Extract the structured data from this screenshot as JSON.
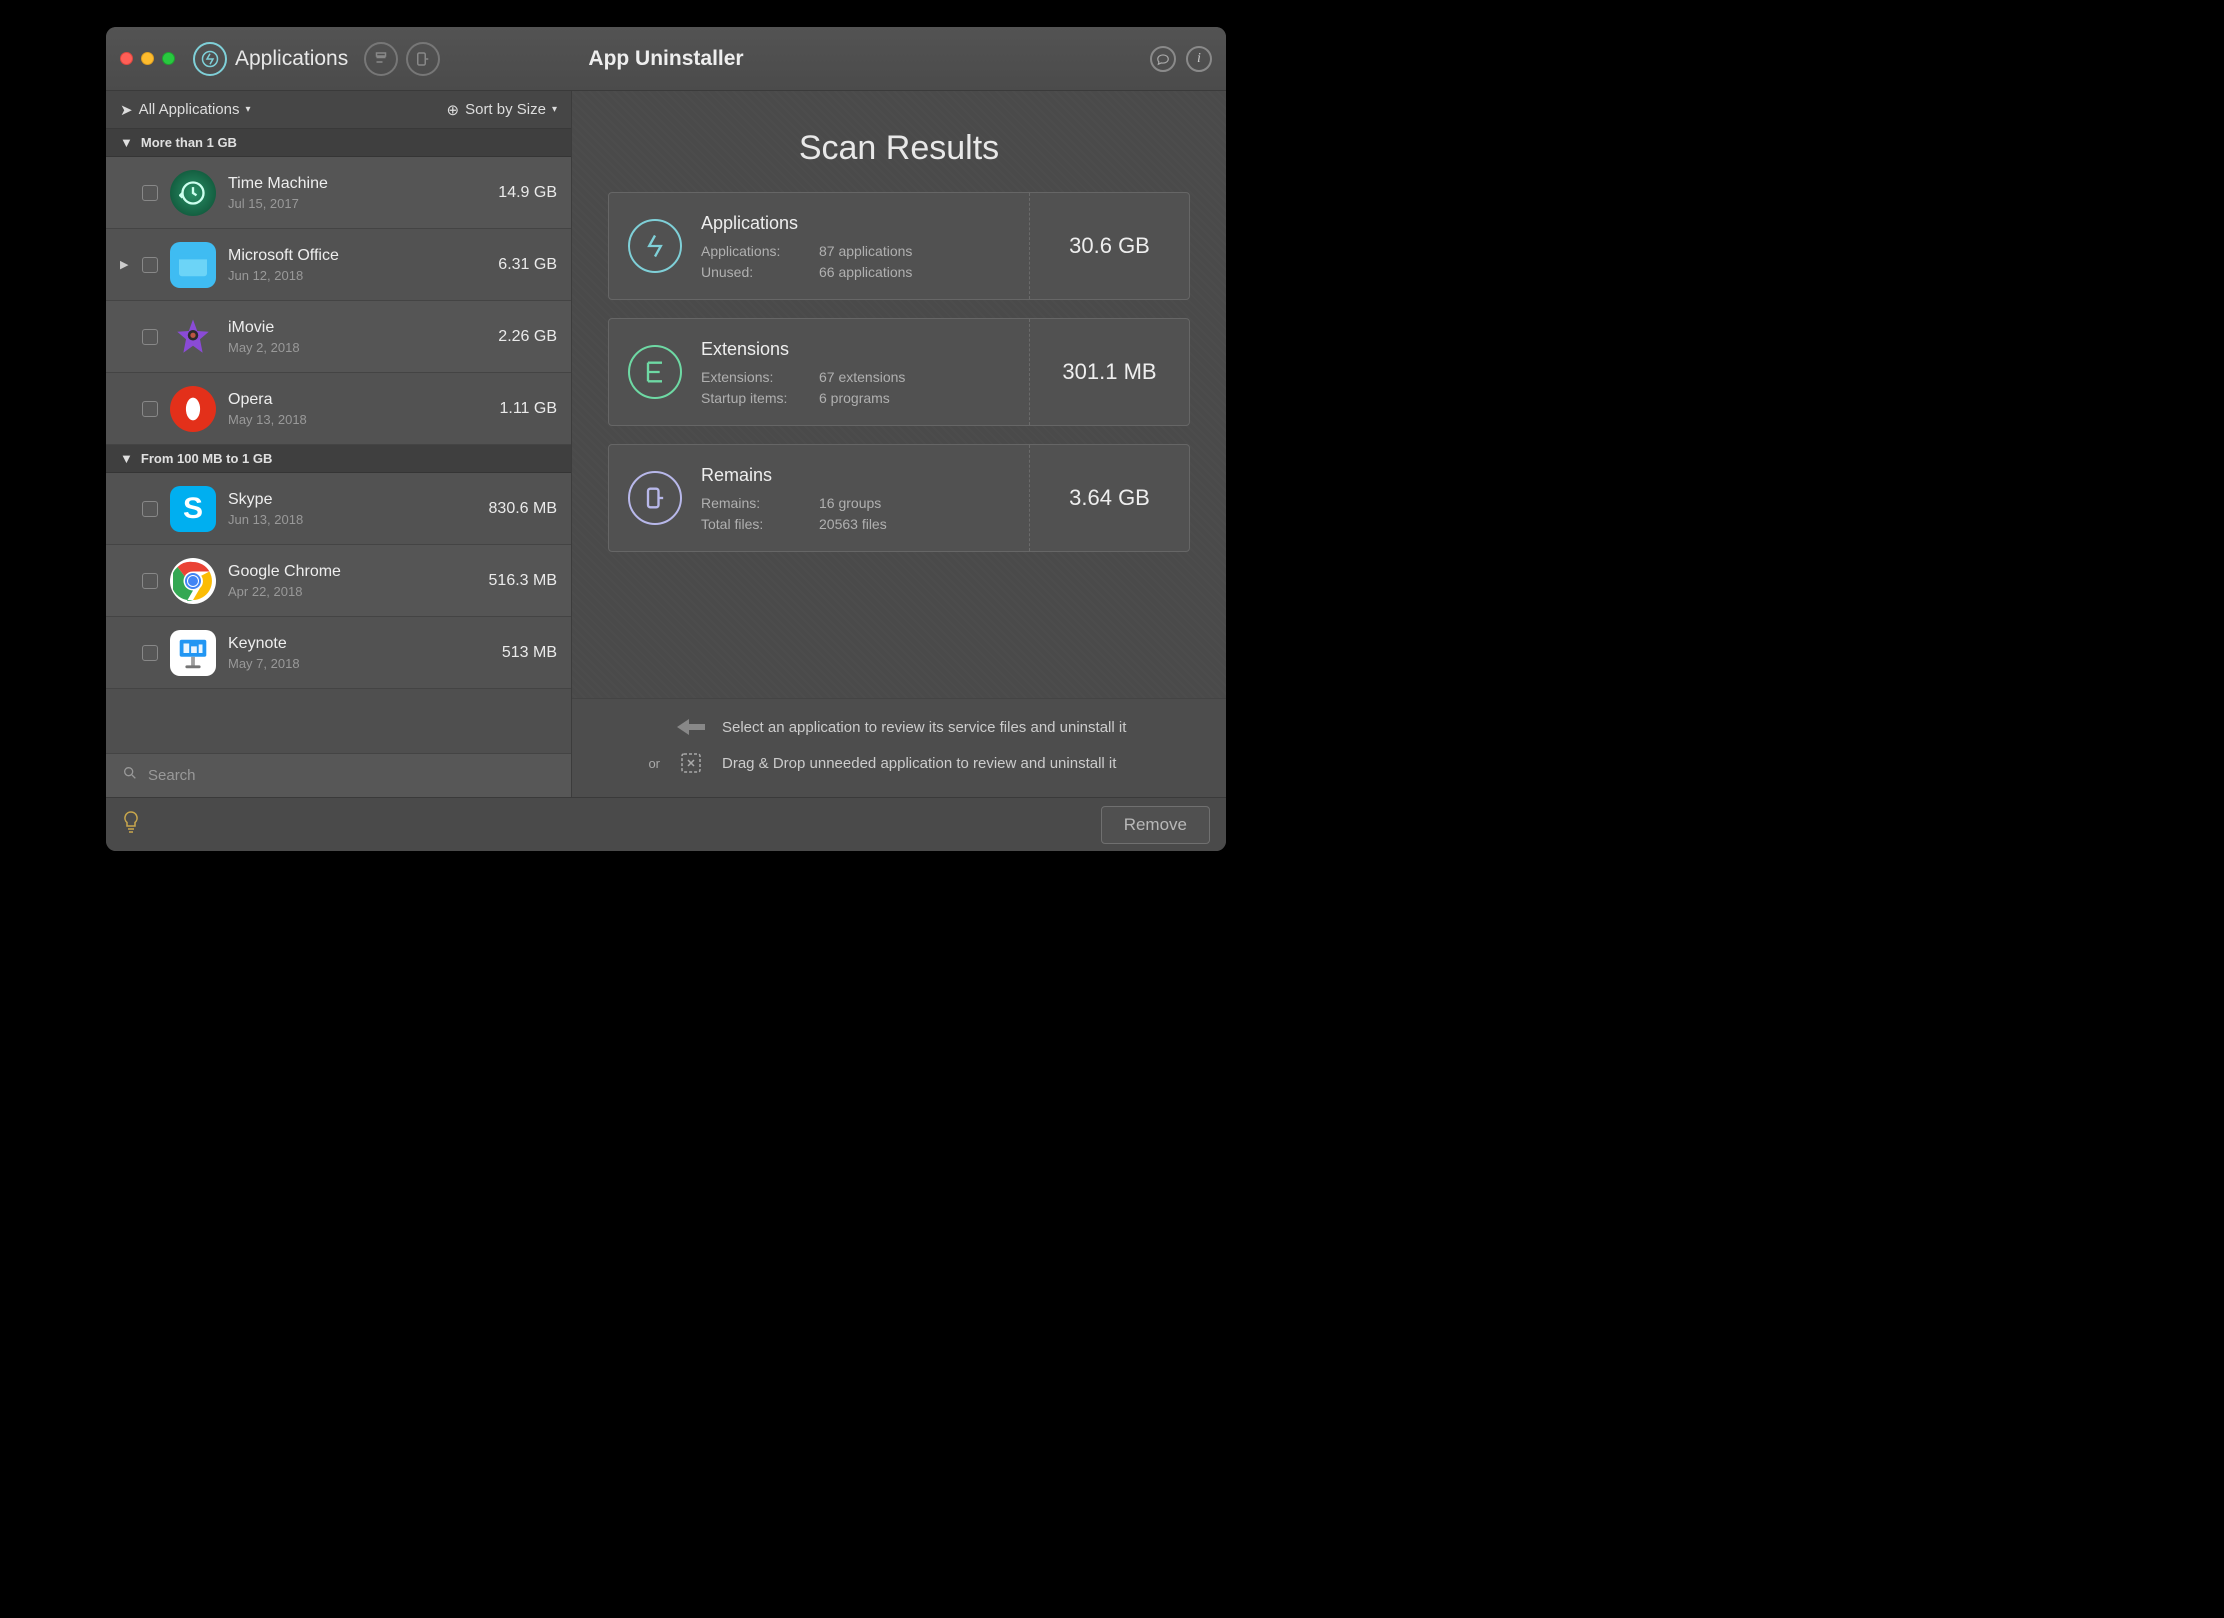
{
  "window": {
    "title": "App Uninstaller",
    "tabs": {
      "applications": "Applications"
    }
  },
  "filter": {
    "scope": "All Applications",
    "sort": "Sort by Size"
  },
  "groups": [
    {
      "label": "More than 1 GB",
      "items": [
        {
          "name": "Time Machine",
          "date": "Jul 15, 2017",
          "size": "14.9 GB",
          "icon": "time-machine",
          "bg": "#106b4a",
          "expandable": false
        },
        {
          "name": "Microsoft Office",
          "date": "Jun 12, 2018",
          "size": "6.31 GB",
          "icon": "folder",
          "bg": "#3fbcf2",
          "expandable": true
        },
        {
          "name": "iMovie",
          "date": "May 2, 2018",
          "size": "2.26 GB",
          "icon": "star",
          "bg": "transparent",
          "expandable": false
        },
        {
          "name": "Opera",
          "date": "May 13, 2018",
          "size": "1.11 GB",
          "icon": "opera",
          "bg": "#e3301a",
          "expandable": false
        }
      ]
    },
    {
      "label": "From 100 MB to 1 GB",
      "items": [
        {
          "name": "Skype",
          "date": "Jun 13, 2018",
          "size": "830.6 MB",
          "icon": "skype",
          "bg": "#00aff0",
          "expandable": false
        },
        {
          "name": "Google Chrome",
          "date": "Apr 22, 2018",
          "size": "516.3 MB",
          "icon": "chrome",
          "bg": "#fff",
          "expandable": false
        },
        {
          "name": "Keynote",
          "date": "May 7, 2018",
          "size": "513 MB",
          "icon": "keynote",
          "bg": "#fff",
          "expandable": false
        }
      ]
    }
  ],
  "search": {
    "placeholder": "Search"
  },
  "scan": {
    "title": "Scan Results",
    "applications": {
      "title": "Applications",
      "rows": [
        {
          "k": "Applications:",
          "v": "87 applications"
        },
        {
          "k": "Unused:",
          "v": "66 applications"
        }
      ],
      "size": "30.6 GB",
      "color": "#7fd0d8"
    },
    "extensions": {
      "title": "Extensions",
      "rows": [
        {
          "k": "Extensions:",
          "v": "67 extensions"
        },
        {
          "k": "Startup items:",
          "v": "6 programs"
        }
      ],
      "size": "301.1 MB",
      "color": "#6ed9a4"
    },
    "remains": {
      "title": "Remains",
      "rows": [
        {
          "k": "Remains:",
          "v": "16 groups"
        },
        {
          "k": "Total files:",
          "v": "20563 files"
        }
      ],
      "size": "3.64 GB",
      "color": "#b8b8ea"
    }
  },
  "hints": {
    "select": "Select an application to review its service files and uninstall it",
    "or": "or",
    "drag": "Drag & Drop unneeded application to review and uninstall it"
  },
  "footer": {
    "remove": "Remove"
  }
}
